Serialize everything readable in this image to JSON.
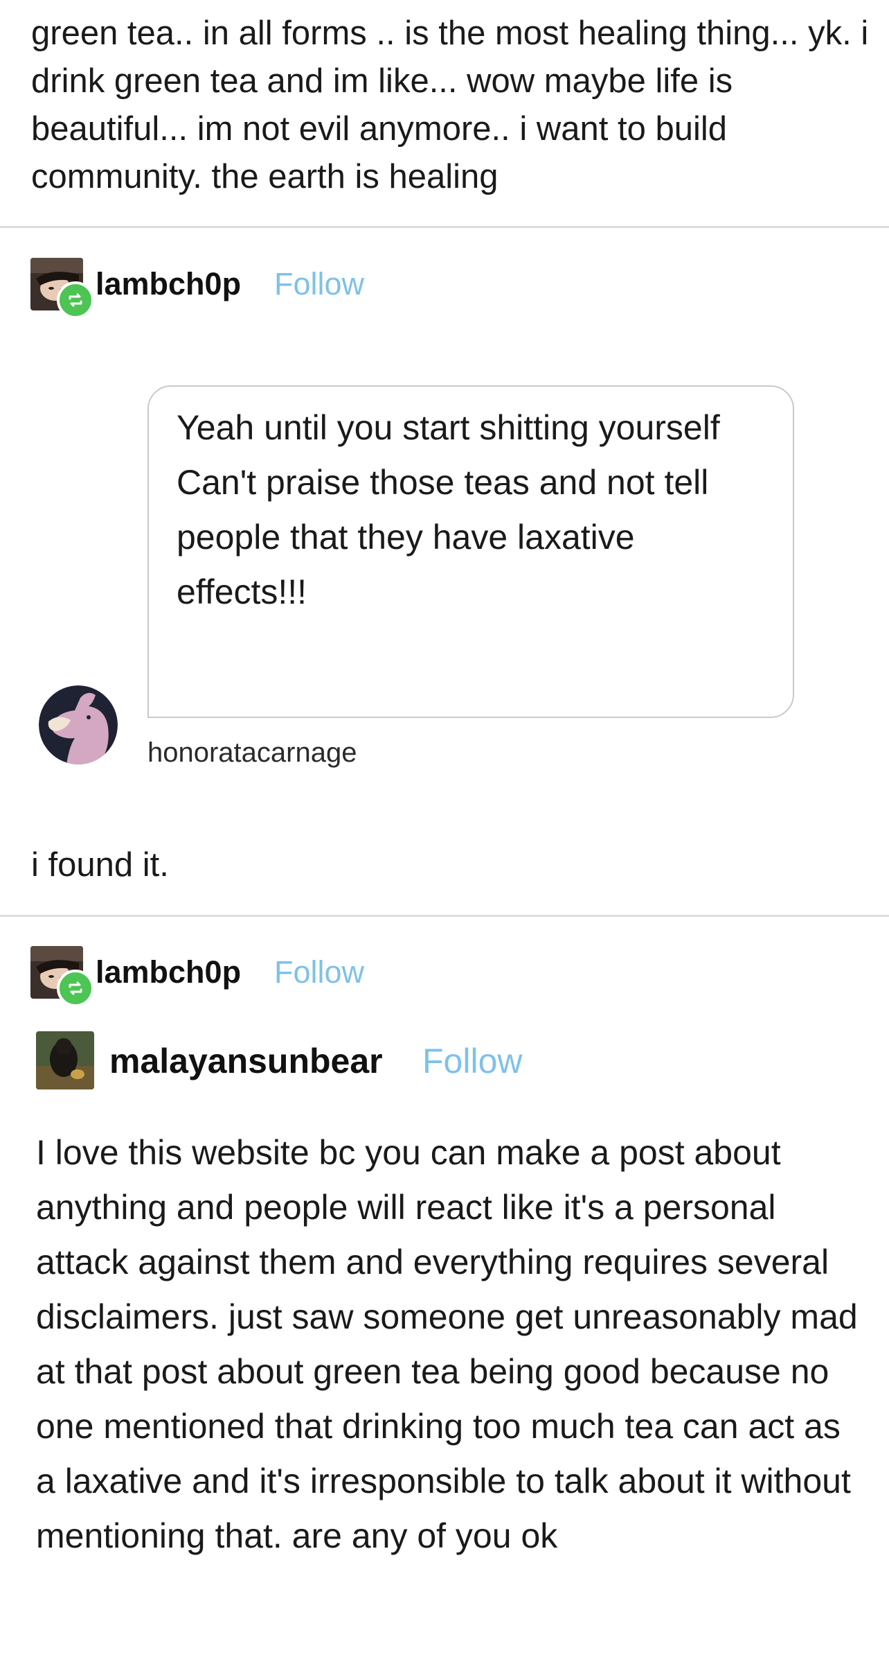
{
  "post1": {
    "text": "green tea.. in all forms .. is the most healing thing... yk. i drink green tea and im like... wow maybe life is beautiful... im not evil anymore.. i want to build community. the earth is healing"
  },
  "reblog1": {
    "username": "lambch0p",
    "follow_label": "Follow",
    "chat": {
      "message": "Yeah until you start shitting yourself\nCan't praise those teas and not tell people that they have laxative effects!!!",
      "sender": "honoratacarnage"
    },
    "comment": "i found it."
  },
  "reblog2": {
    "username": "lambch0p",
    "follow_label": "Follow"
  },
  "post2": {
    "username": "malayansunbear",
    "follow_label": "Follow",
    "text": "I love this website bc you can make a post about anything and people will react like it's a personal attack against them and everything requires several disclaimers. just saw someone get unreasonably mad at that post about green tea being good because no one mentioned that drinking too much tea can act as a laxative and it's irresponsible to talk about it without mentioning that. are any of you ok"
  },
  "colors": {
    "follow": "#7fc1e8",
    "reblog_badge": "#4cc553",
    "divider": "#dcdcdc"
  },
  "icons": [
    "reblog-icon",
    "avatar-lambch0p",
    "avatar-honoratacarnage",
    "avatar-malayansunbear"
  ]
}
